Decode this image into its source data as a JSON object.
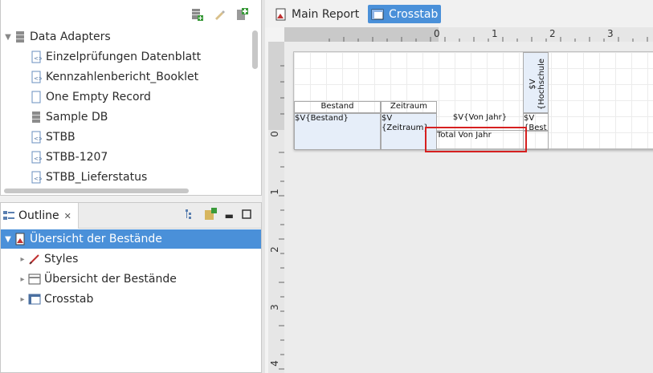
{
  "repository": {
    "root_label": "Data Adapters",
    "items": [
      {
        "label": "Einzelprüfungen Datenblatt",
        "icon": "xml-adapter-icon"
      },
      {
        "label": "Kennzahlenbericht_Booklet",
        "icon": "xml-adapter-icon"
      },
      {
        "label": "One Empty Record",
        "icon": "empty-record-icon"
      },
      {
        "label": "Sample DB",
        "icon": "database-icon"
      },
      {
        "label": "STBB",
        "icon": "xml-adapter-icon"
      },
      {
        "label": "STBB-1207",
        "icon": "xml-adapter-icon"
      },
      {
        "label": "STBB_Lieferstatus",
        "icon": "xml-adapter-icon"
      }
    ]
  },
  "outline": {
    "tab_label": "Outline",
    "root": "Übersicht der Bestände",
    "children": [
      {
        "label": "Styles",
        "icon": "styles-icon"
      },
      {
        "label": "Übersicht der Bestände",
        "icon": "band-icon"
      },
      {
        "label": "Crosstab",
        "icon": "crosstab-icon"
      }
    ]
  },
  "editor": {
    "tabs": [
      {
        "label": "Main Report",
        "active": false
      },
      {
        "label": "Crosstab",
        "active": true
      }
    ],
    "ruler_h": [
      "0",
      "1",
      "2",
      "3"
    ],
    "ruler_v": [
      "0",
      "1",
      "2",
      "3",
      "4"
    ]
  },
  "crosstab": {
    "header_bestand": "Bestand",
    "header_zeitraum": "Zeitraum",
    "col_hochschule_a": "$V",
    "col_hochschule_b": "{Hochschule",
    "row_bestand": "$V{Bestand}",
    "row_zeitraum_a": "$V",
    "row_zeitraum_b": "{Zeitraum}",
    "val_vonjahr": "$V{Von Jahr}",
    "val_best_a": "$V",
    "val_best_b": "{Best",
    "total_label": "Total Von Jahr"
  },
  "colors": {
    "accent": "#4a90d9",
    "highlight": "#d62020"
  }
}
